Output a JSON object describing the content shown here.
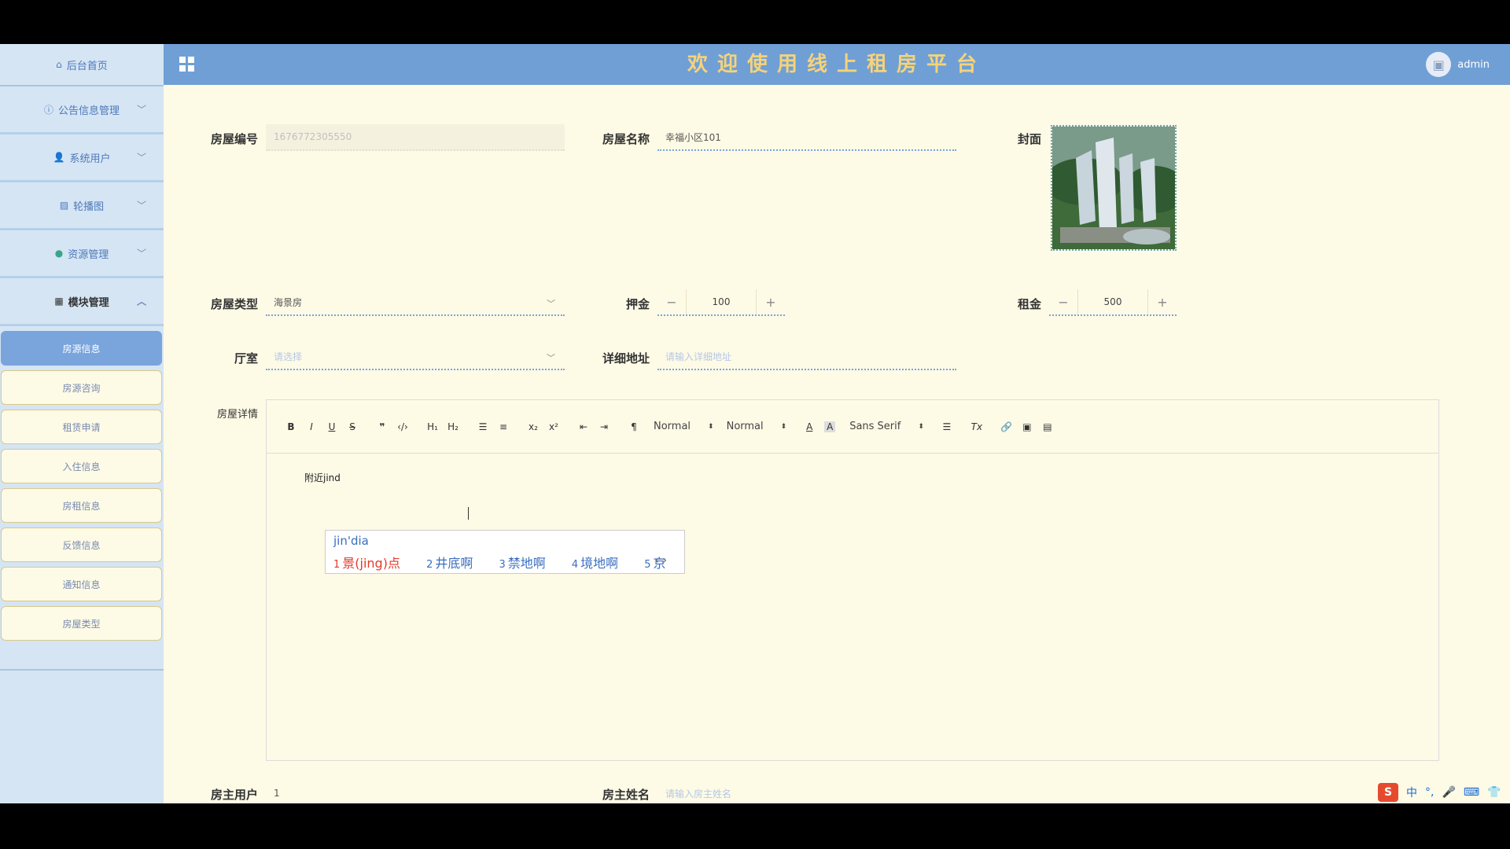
{
  "header": {
    "title": "欢迎使用线上租房平台",
    "user": "admin"
  },
  "sidebar": {
    "home": "后台首页",
    "menus": [
      {
        "label": "公告信息管理",
        "icon": "info-circle-icon",
        "expanded": false
      },
      {
        "label": "系统用户",
        "icon": "user-icon",
        "expanded": false
      },
      {
        "label": "轮播图",
        "icon": "image-icon",
        "expanded": false
      },
      {
        "label": "资源管理",
        "icon": "location-pin-icon",
        "expanded": false
      },
      {
        "label": "模块管理",
        "icon": "grid-icon",
        "expanded": true
      }
    ],
    "sub_items": [
      "房源信息",
      "房源咨询",
      "租赁申请",
      "入住信息",
      "房租信息",
      "反馈信息",
      "通知信息",
      "房屋类型"
    ],
    "active_sub": "房源信息"
  },
  "form": {
    "house_no": {
      "label": "房屋编号",
      "value": "1676772305550"
    },
    "house_name": {
      "label": "房屋名称",
      "value": "幸福小区101"
    },
    "cover": {
      "label": "封面"
    },
    "house_type": {
      "label": "房屋类型",
      "value": "海景房"
    },
    "deposit": {
      "label": "押金",
      "value": "100"
    },
    "rent": {
      "label": "租金",
      "value": "500"
    },
    "hall_room": {
      "label": "厅室",
      "placeholder": "请选择"
    },
    "address": {
      "label": "详细地址",
      "placeholder": "请输入详细地址"
    },
    "details": {
      "label": "房屋详情",
      "content": "附近jind"
    },
    "landlord_user": {
      "label": "房主用户",
      "value": "1"
    },
    "landlord_name": {
      "label": "房主姓名",
      "placeholder": "请输入房主姓名"
    }
  },
  "editor": {
    "header_select": "Normal",
    "size_select": "Normal",
    "font_select": "Sans Serif"
  },
  "ime": {
    "code": "jin'dia",
    "candidates": [
      {
        "n": "1",
        "text": "景(jing)点"
      },
      {
        "n": "2",
        "text": "井底啊"
      },
      {
        "n": "3",
        "text": "禁地啊"
      },
      {
        "n": "4",
        "text": "境地啊"
      },
      {
        "n": "5",
        "text": "京"
      }
    ]
  },
  "tray": {
    "lang": "中"
  }
}
